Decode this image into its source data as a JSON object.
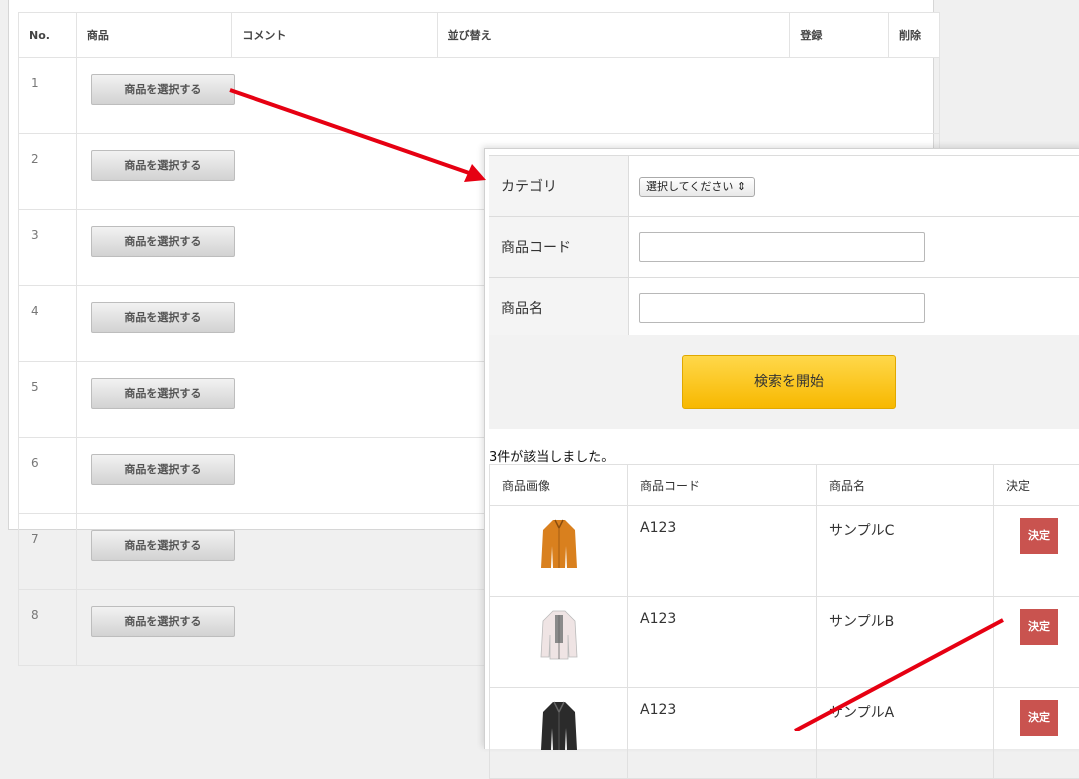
{
  "back_table": {
    "headers": [
      "No.",
      "商品",
      "コメント",
      "並び替え",
      "登録",
      "削除"
    ],
    "rows": [
      {
        "no": "1",
        "button": "商品を選択する"
      },
      {
        "no": "2",
        "button": "商品を選択する"
      },
      {
        "no": "3",
        "button": "商品を選択する"
      },
      {
        "no": "4",
        "button": "商品を選択する"
      },
      {
        "no": "5",
        "button": "商品を選択する"
      },
      {
        "no": "6",
        "button": "商品を選択する"
      },
      {
        "no": "7",
        "button": "商品を選択する"
      },
      {
        "no": "8",
        "button": "商品を選択する"
      }
    ]
  },
  "search_form": {
    "category_label": "カテゴリ",
    "category_value": "選択してください",
    "code_label": "商品コード",
    "name_label": "商品名",
    "search_button": "検索を開始"
  },
  "results": {
    "count_text": "3件が該当しました。",
    "headers": [
      "商品画像",
      "商品コード",
      "商品名",
      "決定"
    ],
    "rows": [
      {
        "image": "orange-jacket",
        "code": "A123",
        "name": "サンプルC",
        "decide": "決定"
      },
      {
        "image": "white-shirt",
        "code": "A123",
        "name": "サンプルB",
        "decide": "決定"
      },
      {
        "image": "black-jacket",
        "code": "A123",
        "name": "サンプルA",
        "decide": "決定"
      }
    ]
  },
  "colors": {
    "arrow": "#e60012",
    "search_button": "#f7b800",
    "decide_button": "#c9534f"
  }
}
